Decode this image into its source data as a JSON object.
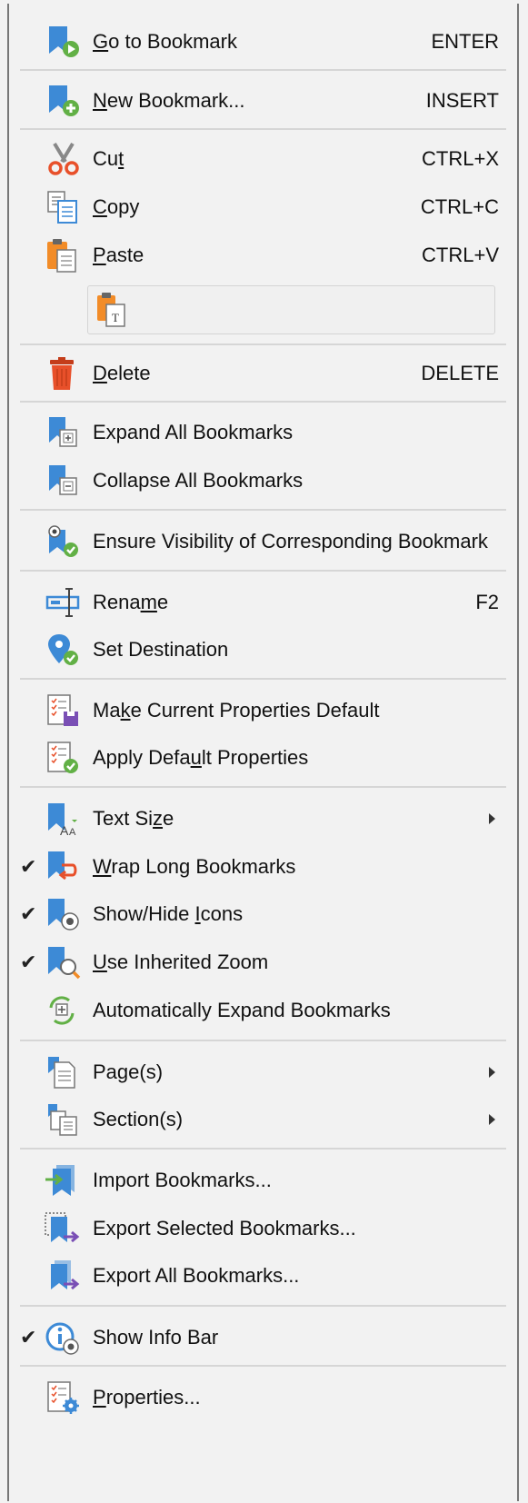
{
  "menu": {
    "go_to_bookmark": {
      "pre": "",
      "u": "G",
      "post": "o to Bookmark",
      "shortcut": "ENTER"
    },
    "new_bookmark": {
      "pre": "",
      "u": "N",
      "post": "ew Bookmark...",
      "shortcut": "INSERT"
    },
    "cut": {
      "pre": "Cu",
      "u": "t",
      "post": "",
      "shortcut": "CTRL+X"
    },
    "copy": {
      "pre": "",
      "u": "C",
      "post": "opy",
      "shortcut": "CTRL+C"
    },
    "paste": {
      "pre": "",
      "u": "P",
      "post": "aste",
      "shortcut": "CTRL+V"
    },
    "delete": {
      "pre": "",
      "u": "D",
      "post": "elete",
      "shortcut": "DELETE"
    },
    "expand_all": {
      "label": "Expand All Bookmarks"
    },
    "collapse_all": {
      "label": "Collapse All Bookmarks"
    },
    "ensure_visibility": {
      "label": "Ensure Visibility of Corresponding Bookmark"
    },
    "rename": {
      "pre": "Rena",
      "u": "m",
      "post": "e",
      "shortcut": "F2"
    },
    "set_destination": {
      "label": "Set Destination"
    },
    "make_default": {
      "pre": "Ma",
      "u": "k",
      "post": "e Current Properties Default"
    },
    "apply_default": {
      "pre": "Apply Defa",
      "u": "u",
      "post": "lt Properties"
    },
    "text_size": {
      "pre": "Text Si",
      "u": "z",
      "post": "e"
    },
    "wrap_long": {
      "pre": "",
      "u": "W",
      "post": "rap Long Bookmarks",
      "checked": "✔"
    },
    "show_hide_icons": {
      "pre": "Show/Hide ",
      "u": "I",
      "post": "cons",
      "checked": "✔"
    },
    "use_inherited_zoom": {
      "pre": "",
      "u": "U",
      "post": "se Inherited Zoom",
      "checked": "✔"
    },
    "auto_expand": {
      "label": "Automatically Expand Bookmarks"
    },
    "pages": {
      "label": "Page(s)"
    },
    "sections": {
      "label": "Section(s)"
    },
    "import": {
      "label": "Import Bookmarks..."
    },
    "export_selected": {
      "label": "Export Selected Bookmarks..."
    },
    "export_all": {
      "label": "Export All Bookmarks..."
    },
    "show_info_bar": {
      "label": "Show Info Bar",
      "checked": "✔"
    },
    "properties": {
      "pre": "",
      "u": "P",
      "post": "roperties..."
    }
  },
  "colors": {
    "bookmark_blue": "#3d8ad6",
    "green": "#62b046",
    "orange": "#f28c28",
    "red": "#e8502a",
    "purple": "#7a4fb5"
  }
}
